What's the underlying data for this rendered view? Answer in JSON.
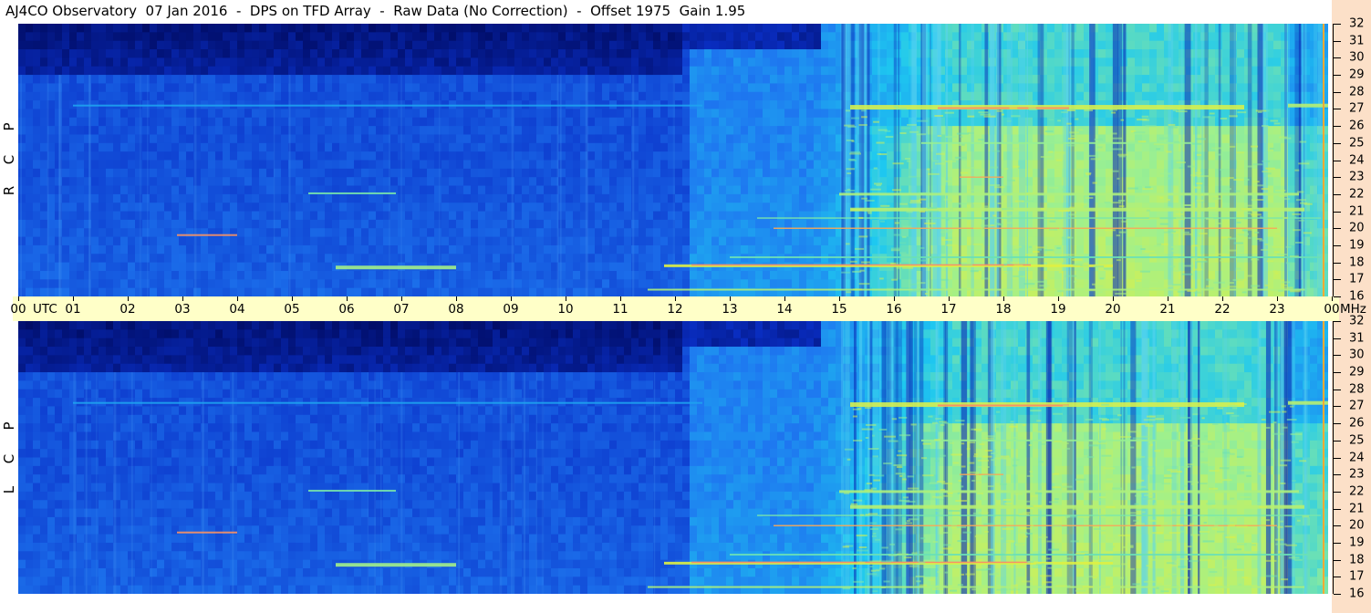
{
  "header": {
    "title": "AJ4CO Observatory  07 Jan 2016  -  DPS on TFD Array  -  Raw Data (No Correction)  -  Offset 1975  Gain 1.95"
  },
  "panels": [
    {
      "label_letters": [
        "R",
        "C",
        "P"
      ]
    },
    {
      "label_letters": [
        "L",
        "C",
        "P"
      ]
    }
  ],
  "time_axis": {
    "unit_label": "UTC",
    "tick_labels": [
      "00",
      "01",
      "02",
      "03",
      "04",
      "05",
      "06",
      "07",
      "08",
      "09",
      "10",
      "11",
      "12",
      "13",
      "14",
      "15",
      "16",
      "17",
      "18",
      "19",
      "20",
      "21",
      "22",
      "23",
      "00"
    ]
  },
  "freq_axis": {
    "unit_label": "MHz",
    "tick_labels": [
      "32",
      "31",
      "30",
      "29",
      "28",
      "27",
      "26",
      "25",
      "24",
      "23",
      "22",
      "21",
      "20",
      "19",
      "18",
      "17",
      "16"
    ]
  },
  "colors": {
    "time_band": "#ffffc8",
    "freq_axis_band": "#fce0c8",
    "colormap": [
      "#000a60",
      "#0a30c8",
      "#1e78f0",
      "#1ec8f0",
      "#9cf090",
      "#f0f030",
      "#ff3c96"
    ]
  },
  "chart_data": {
    "type": "heatmap",
    "title": "AJ4CO Observatory  07 Jan 2016  -  DPS on TFD Array  -  Raw Data (No Correction)  -  Offset 1975  Gain 1.95",
    "xlabel": "UTC",
    "ylabel": "MHz",
    "x_range_hours": [
      0,
      24
    ],
    "y_range_mhz": [
      16,
      32
    ],
    "x_tick_labels": [
      "00",
      "01",
      "02",
      "03",
      "04",
      "05",
      "06",
      "07",
      "08",
      "09",
      "10",
      "11",
      "12",
      "13",
      "14",
      "15",
      "16",
      "17",
      "18",
      "19",
      "20",
      "21",
      "22",
      "23",
      "00"
    ],
    "y_tick_labels": [
      "16",
      "17",
      "18",
      "19",
      "20",
      "21",
      "22",
      "23",
      "24",
      "25",
      "26",
      "27",
      "28",
      "29",
      "30",
      "31",
      "32"
    ],
    "panels": [
      "RCP",
      "LCP"
    ],
    "colormap": [
      "#000a60",
      "#0a30c8",
      "#1e78f0",
      "#1ec8f0",
      "#9cf090",
      "#f0f030",
      "#ff3c96"
    ],
    "features": {
      "low_band_dark_until_hour": 12.2,
      "bright_period_hours": [
        14.5,
        23.9
      ],
      "strong_lines_mhz": [
        27.1,
        17.8,
        22.0,
        21.1
      ]
    }
  }
}
